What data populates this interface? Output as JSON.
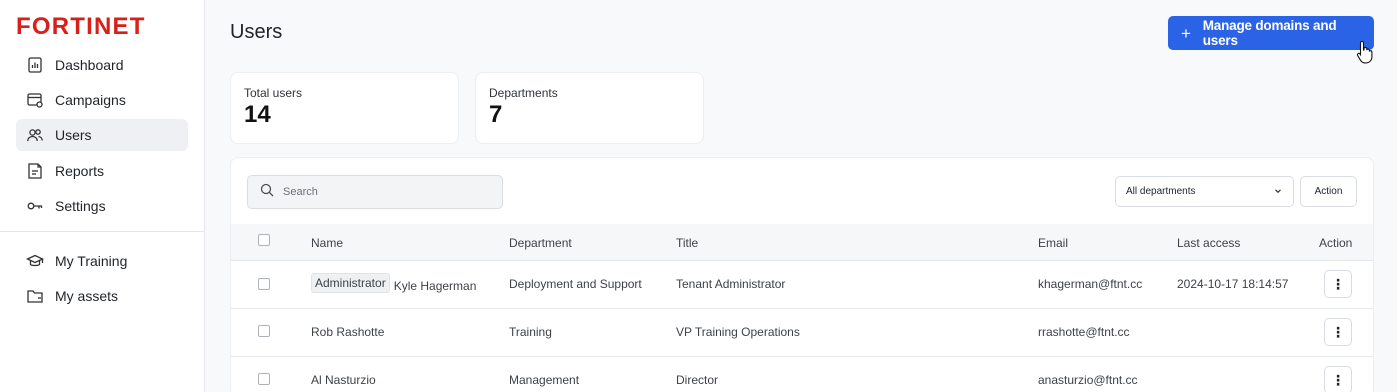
{
  "brand": {
    "name": "FORTINET",
    "accent": "#2b63e6"
  },
  "sidebar": {
    "items": [
      {
        "label": "Dashboard",
        "icon": "dashboard-icon"
      },
      {
        "label": "Campaigns",
        "icon": "campaigns-icon"
      },
      {
        "label": "Users",
        "icon": "users-icon",
        "active": true
      },
      {
        "label": "Reports",
        "icon": "reports-icon"
      },
      {
        "label": "Settings",
        "icon": "key-icon"
      }
    ],
    "secondary": [
      {
        "label": "My Training",
        "icon": "graduation-cap-icon"
      },
      {
        "label": "My assets",
        "icon": "folder-icon"
      }
    ]
  },
  "header": {
    "title": "Users",
    "primary_button": "Manage domains and users",
    "primary_icon": "+"
  },
  "stats": [
    {
      "label": "Total users",
      "value": "14"
    },
    {
      "label": "Departments",
      "value": "7"
    }
  ],
  "toolbar": {
    "search_placeholder": "Search",
    "department_filter": "All departments",
    "action_label": "Action"
  },
  "table": {
    "columns": [
      "Name",
      "Department",
      "Title",
      "Email",
      "Last access",
      "Action"
    ],
    "rows": [
      {
        "badge": "Administrator",
        "name": "Kyle Hagerman",
        "department": "Deployment and Support",
        "title": "Tenant Administrator",
        "email": "khagerman@ftnt.cc",
        "last_access": "2024-10-17 18:14:57",
        "menu": "⋮"
      },
      {
        "badge": "",
        "name": "Rob Rashotte",
        "department": "Training",
        "title": "VP Training Operations",
        "email": "rrashotte@ftnt.cc",
        "last_access": "",
        "menu": "⋮"
      },
      {
        "badge": "",
        "name": "Al Nasturzio",
        "department": "Management",
        "title": "Director",
        "email": "anasturzio@ftnt.cc",
        "last_access": "",
        "menu": "⋮"
      }
    ]
  }
}
